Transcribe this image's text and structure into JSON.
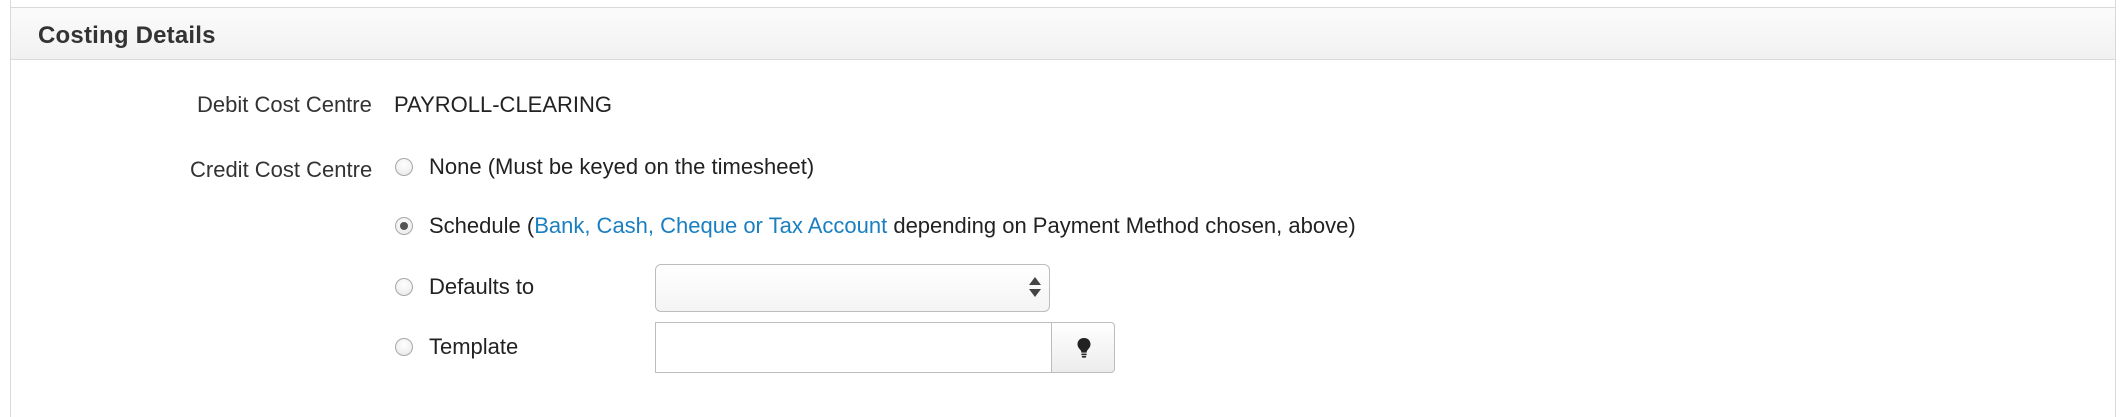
{
  "section": {
    "title": "Costing Details"
  },
  "debit_cost_centre": {
    "label": "Debit Cost Centre",
    "value": "PAYROLL-CLEARING"
  },
  "credit_cost_centre": {
    "label": "Credit Cost Centre",
    "options": [
      {
        "label": "None (Must be keyed on the timesheet)",
        "checked": false
      },
      {
        "prefix": "Schedule (",
        "link": "Bank, Cash, Cheque or Tax Account",
        "suffix": " depending on Payment Method chosen, above)",
        "checked": true
      },
      {
        "label": "Defaults to",
        "checked": false
      },
      {
        "label": "Template",
        "checked": false
      }
    ],
    "defaults_to_select": {
      "value": ""
    },
    "template_input": {
      "value": "",
      "button_icon": "lightbulb-icon"
    }
  },
  "colors": {
    "link": "#1a7fc1",
    "header_bg": "#f1f1f1",
    "border": "#d9d9d9"
  }
}
